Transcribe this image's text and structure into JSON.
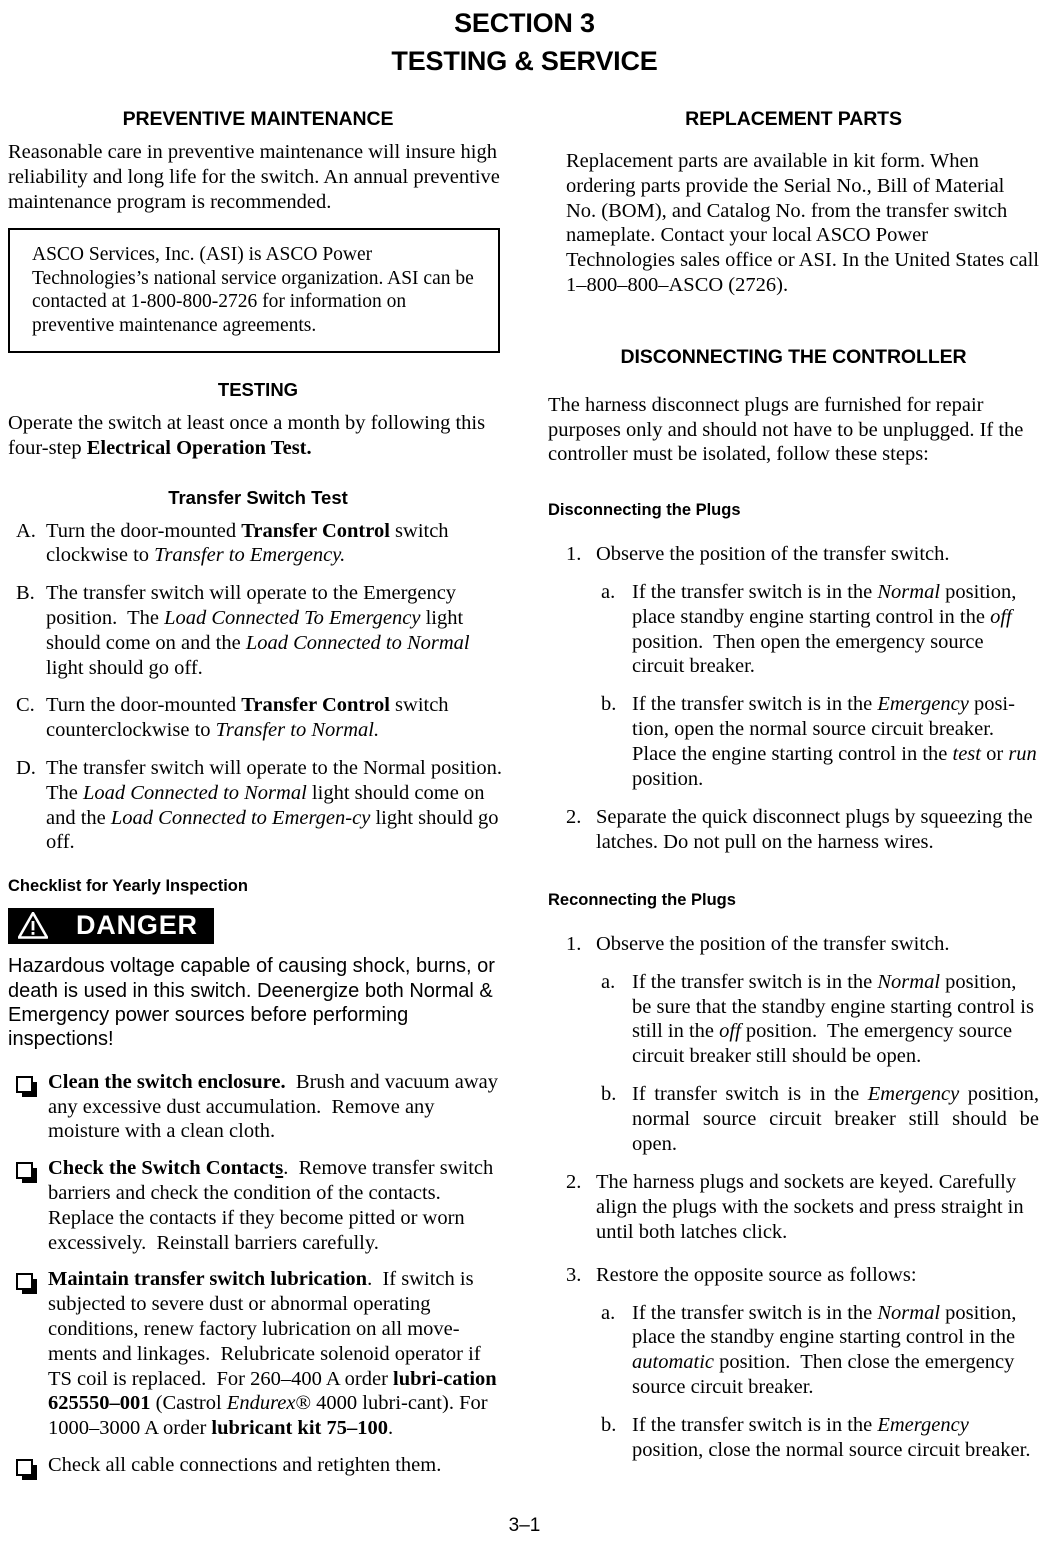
{
  "document": {
    "section_line1": "SECTION 3",
    "section_line2": "TESTING & SERVICE",
    "page_number": "3–1"
  },
  "left_column": {
    "preventive_maintenance": {
      "heading": "PREVENTIVE MAINTENANCE",
      "paragraph": "Reasonable care in preventive maintenance will insure high reliability and long life for the switch.  An annual preventive maintenance program is recommended.",
      "callout": "ASCO Services, Inc. (ASI) is ASCO Power Technologies’s national service organization. ASI can be contacted at 1-800-800-2726 for information on preventive maintenance agreements."
    },
    "testing": {
      "heading": "TESTING",
      "intro_plain_1": "Operate the switch at least once a month by following this four-step ",
      "intro_bold": "Electrical Operation Test.",
      "transfer_switch_test_heading": "Transfer Switch Test",
      "steps": [
        {
          "marker": "A.",
          "text": "Turn the door-mounted Transfer Control switch clockwise to Transfer to Emergency."
        },
        {
          "marker": "B.",
          "text": "The transfer switch will operate to the Emergency position.  The Load Connected To Emergency light should come on and the Load Connected to Normal light should go off."
        },
        {
          "marker": "C.",
          "text": "Turn the door-mounted Transfer Control switch counterclockwise to Transfer to Normal."
        },
        {
          "marker": "D.",
          "text": "The transfer switch will operate to the Normal position.  The Load Connected to Normal light should come on and the Load Connected to Emergency light should go off."
        }
      ]
    },
    "checklist": {
      "heading": "Checklist for Yearly Inspection",
      "danger_label": "DANGER",
      "danger_icon": "warning-triangle-icon",
      "danger_text": "Hazardous voltage capable of causing shock, burns, or death is used in this switch. Deenergize both Normal & Emergency power sources before performing inspections!",
      "items": [
        {
          "title": "Clean the switch enclosure.",
          "text": "Brush and vacuum away any excessive dust accumulation.  Remove any moisture with a clean cloth."
        },
        {
          "title": "Check the Switch Contacts.",
          "text": "Remove transfer switch barriers and check the condition of the contacts. Replace the contacts if they become pitted or worn excessively.  Reinstall barriers carefully."
        },
        {
          "title": "Maintain transfer switch lubrication.",
          "text": "If switch is subjected to severe dust or abnormal operating conditions, renew factory lubrication on all movements and linkages.  Relubricate solenoid operator if TS coil is replaced.  For 260–400 A order lubrication 625550–001 (Castrol Endurex® 4000 lubricant). For 1000–3000 A order lubricant kit 75–100."
        },
        {
          "title": "",
          "text": "Check all cable connections and retighten them."
        }
      ]
    }
  },
  "right_column": {
    "replacement_parts": {
      "heading": "REPLACEMENT PARTS",
      "paragraph": "Replacement parts are available in kit form.  When ordering parts provide the Serial No., Bill of Material No. (BOM), and Catalog No. from the transfer switch nameplate.  Contact your local ASCO Power Technologies sales office or ASI.  In the United States call 1–800–800–ASCO (2726)."
    },
    "disconnecting_controller": {
      "heading": "DISCONNECTING THE CONTROLLER",
      "paragraph": "The harness disconnect plugs are furnished for repair purposes only and should not have to be unplugged. If the controller must be isolated, follow these steps:",
      "disconnecting_plugs": {
        "heading": "Disconnecting the Plugs",
        "steps": [
          {
            "marker": "1.",
            "text": "Observe the position of the transfer switch.",
            "substeps": [
              {
                "marker": "a.",
                "text": "If the transfer switch is in the Normal position, place standby engine starting control in the off position.  Then open the emergency source circuit breaker."
              },
              {
                "marker": "b.",
                "text": "If the transfer switch is in the Emergency position, open the normal source circuit breaker. Place the engine starting control in the test or run position."
              }
            ]
          },
          {
            "marker": "2.",
            "text": "Separate the quick disconnect plugs by squeezing the latches.  Do not pull on the harness wires.",
            "substeps": []
          }
        ]
      },
      "reconnecting_plugs": {
        "heading": "Reconnecting the Plugs",
        "steps": [
          {
            "marker": "1.",
            "text": "Observe the position of the transfer switch.",
            "substeps": [
              {
                "marker": "a.",
                "text": "If the transfer switch is in the Normal position, be sure that the standby engine starting control is still in the off position.  The emergency source circuit breaker still should be open."
              },
              {
                "marker": "b.",
                "text": "If transfer switch is in the Emergency position, normal source circuit breaker still should be open."
              }
            ]
          },
          {
            "marker": "2.",
            "text": "The harness plugs and sockets are keyed. Carefully align the plugs with the sockets and press straight in until both latches click.",
            "substeps": []
          },
          {
            "marker": "3.",
            "text": "Restore the opposite source as follows:",
            "substeps": [
              {
                "marker": "a.",
                "text": "If the transfer switch is in the Normal position, place the standby engine starting control in the automatic position.  Then close the emergency source circuit breaker."
              },
              {
                "marker": "b.",
                "text": "If the transfer switch is in the Emergency position, close the normal source circuit breaker."
              }
            ]
          }
        ]
      }
    }
  }
}
